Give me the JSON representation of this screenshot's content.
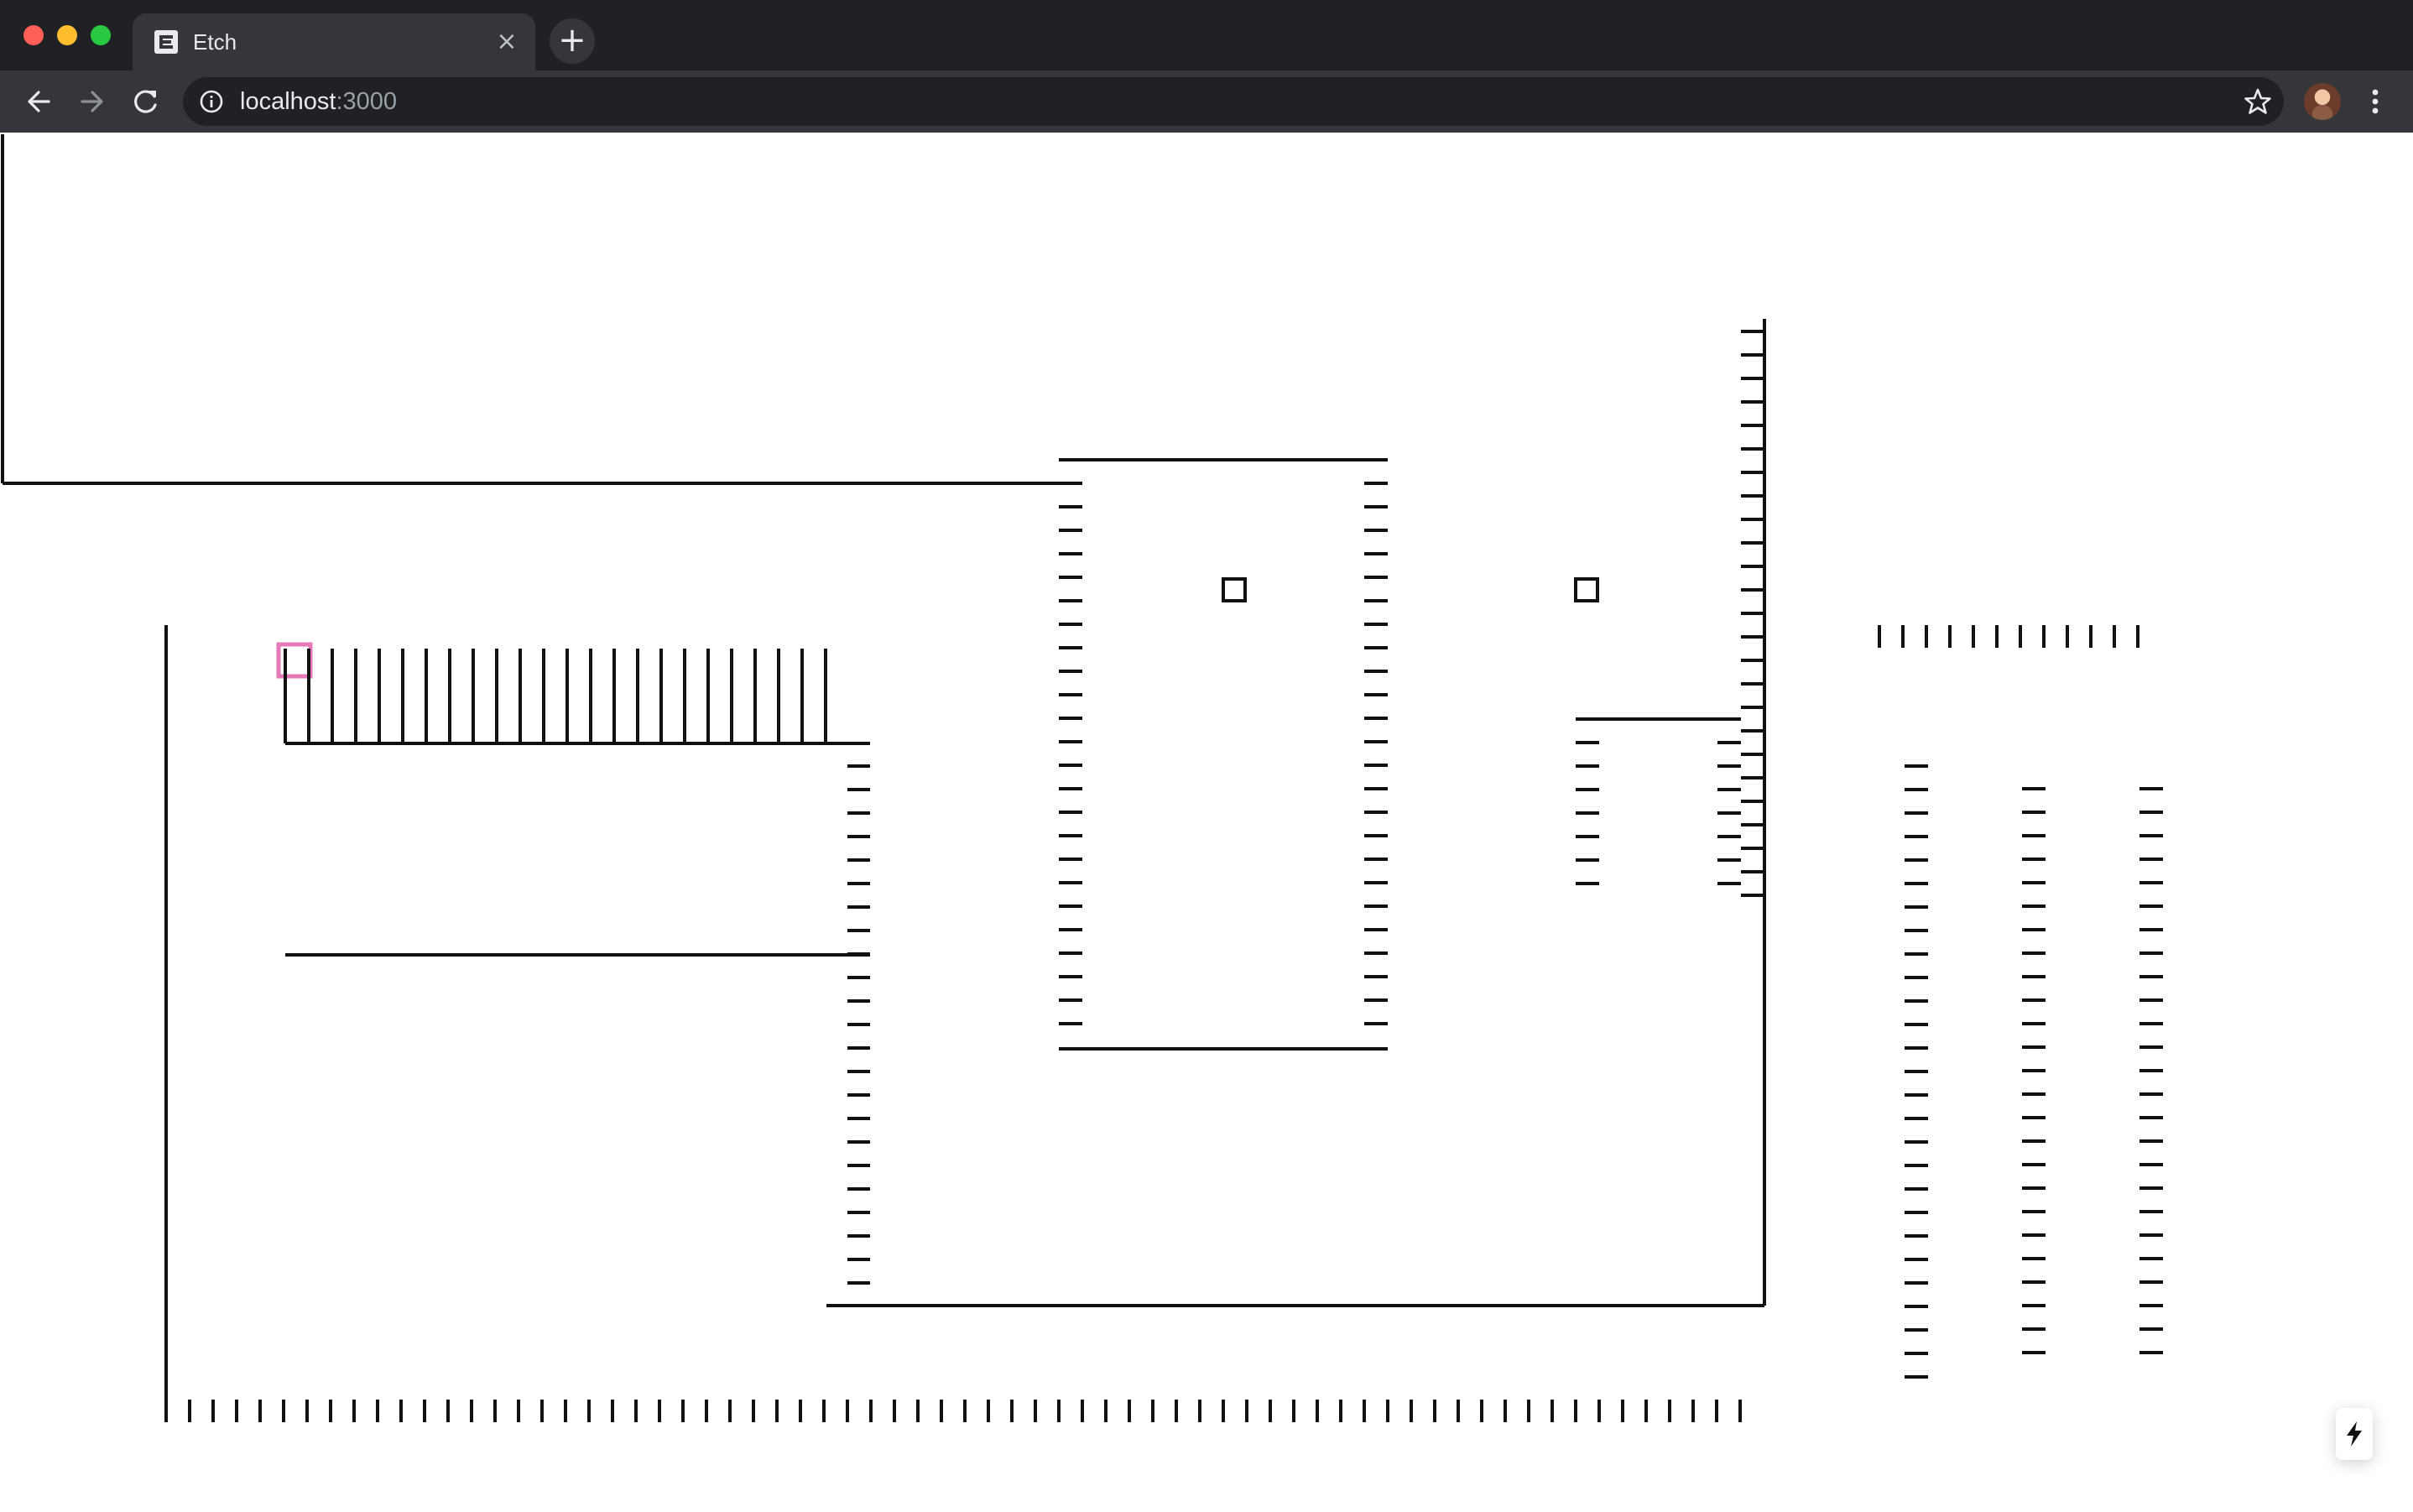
{
  "browser": {
    "tab": {
      "title": "Etch",
      "favicon": "etch-logo-icon",
      "close_glyph": "×"
    },
    "new_tab_glyph": "+",
    "address": {
      "host": "localhost",
      "port": ":3000",
      "info_icon": "info-icon"
    },
    "icons": [
      "back-arrow-icon",
      "forward-arrow-icon",
      "reload-icon",
      "star-icon",
      "avatar",
      "more-vert-icon"
    ]
  },
  "page": {
    "app": "Etch",
    "drawing": {
      "description_icons": [
        "wire-segments",
        "pad-squares",
        "selection-marker"
      ],
      "selection_color": "#e879b9",
      "stroke_color": "#111111"
    },
    "flash_button_icon": "lightning-bolt-icon"
  }
}
